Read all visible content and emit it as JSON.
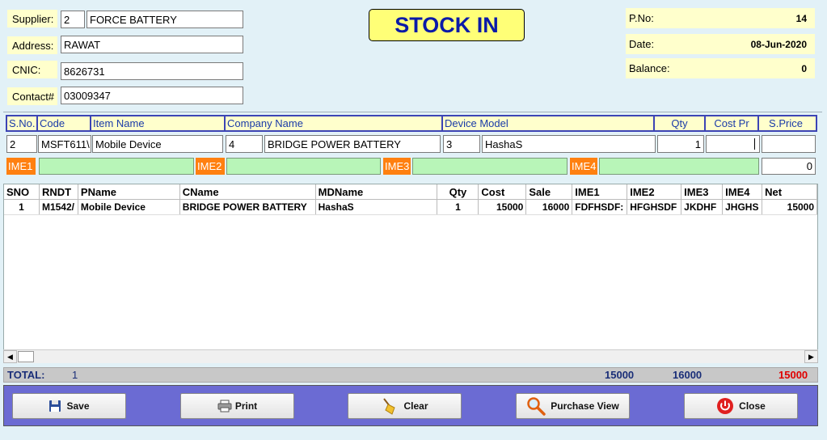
{
  "supplier": {
    "label": "Supplier:",
    "id": "2",
    "name": "FORCE BATTERY"
  },
  "address": {
    "label": "Address:",
    "value": "RAWAT"
  },
  "cnic": {
    "label": "CNIC:",
    "value": "8626731"
  },
  "contact": {
    "label": "Contact#",
    "value": "03009347"
  },
  "title": "STOCK IN",
  "pno": {
    "label": "P.No:",
    "value": "14"
  },
  "date": {
    "label": "Date:",
    "value": "08-Jun-2020"
  },
  "balance": {
    "label": "Balance:",
    "value": "0"
  },
  "entry_headers": [
    "S.No.",
    "Code",
    "Item Name",
    "Company Name",
    "Device Model",
    "Qty",
    "Cost Pr",
    "S.Price"
  ],
  "entry": {
    "sno": "2",
    "code": "MSFT611\\",
    "item_name": "Mobile Device",
    "company_id": "4",
    "company_name": "BRIDGE POWER BATTERY",
    "model_id": "3",
    "model_name": "HashaS",
    "qty": "1",
    "cost": "",
    "sprice": "",
    "ime_total": "0"
  },
  "ime_labels": [
    "IME1",
    "IME2",
    "IME3",
    "IME4"
  ],
  "grid": {
    "headers": [
      "SNO",
      "RNDT",
      "PName",
      "CName",
      "MDName",
      "Qty",
      "Cost",
      "Sale",
      "IME1",
      "IME2",
      "IME3",
      "IME4",
      "Net"
    ],
    "rows": [
      [
        "1",
        "M1542/",
        "Mobile Device",
        "BRIDGE POWER BATTERY",
        "HashaS",
        "1",
        "15000",
        "16000",
        "FDFHSDF:",
        "HFGHSDF",
        "JKDHF",
        "JHGHS",
        "15000"
      ]
    ]
  },
  "totals": {
    "label": "TOTAL:",
    "count": "1",
    "cost": "15000",
    "sale": "16000",
    "net": "15000",
    "net_color": "#e00000"
  },
  "buttons": {
    "save": "Save",
    "print": "Print",
    "clear": "Clear",
    "purchase_view": "Purchase View",
    "close": "Close"
  }
}
